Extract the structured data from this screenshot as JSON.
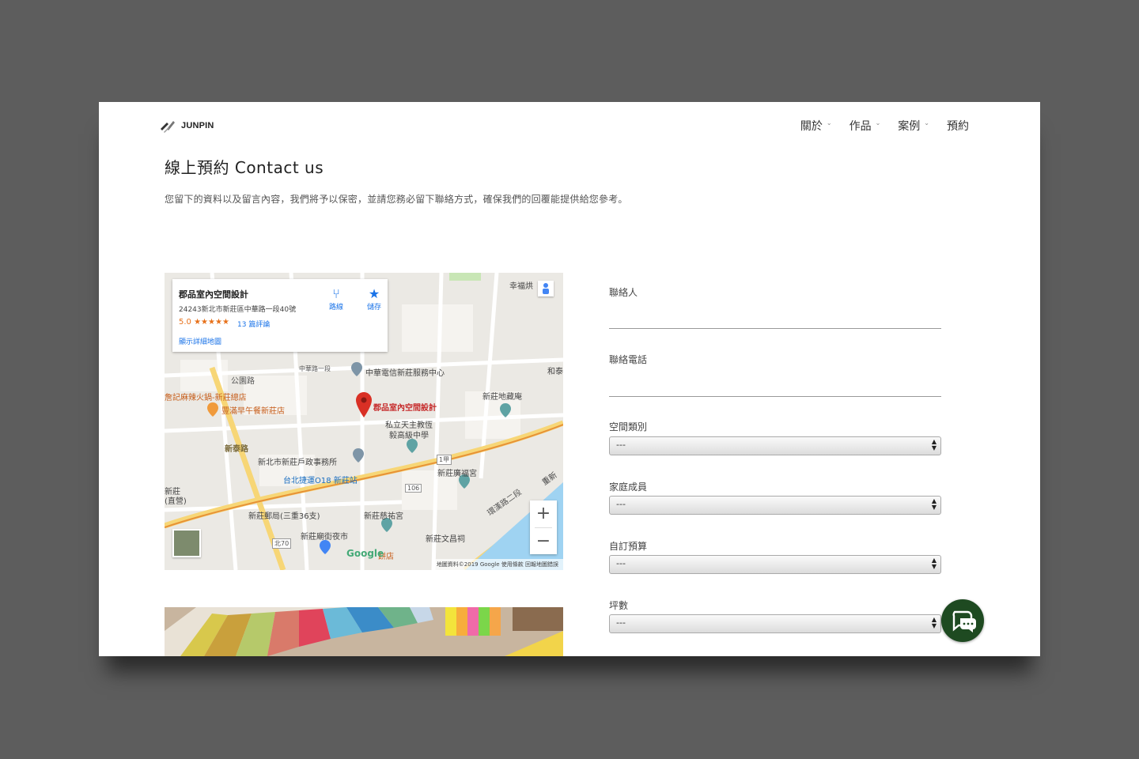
{
  "header": {
    "logo_text": "JUNPIN",
    "nav": [
      {
        "label": "關於",
        "has_dropdown": true
      },
      {
        "label": "作品",
        "has_dropdown": true
      },
      {
        "label": "案例",
        "has_dropdown": true
      },
      {
        "label": "預約",
        "has_dropdown": false
      }
    ]
  },
  "page": {
    "title": "線上預約 Contact us",
    "subtitle": "您留下的資料以及留言內容，我們將予以保密，並請您務必留下聯絡方式，確保我們的回覆能提供給您參考。"
  },
  "map": {
    "card": {
      "place_name": "郡品室內空間設計",
      "address": "24243新北市新莊區中華路一段40號",
      "rating": "5.0 ★★★★★",
      "reviews": "13 篇評論",
      "larger_map": "顯示詳細地圖",
      "directions": "路線",
      "save": "儲存"
    },
    "labels": {
      "marker": "郡品室內空間設計",
      "school_1": "私立天主教恆",
      "school_2": "毅高級中學",
      "telecom": "中華電信新莊服務中心",
      "temple_1": "新莊地藏庵",
      "restaurant_1": "詹記麻辣火鍋-新莊總店",
      "restaurant_2": "豐滿早午餐新莊店",
      "household": "新北市新莊戶政事務所",
      "metro": "台北捷運O18 新莊站",
      "temple_2": "新莊廣福宮",
      "post": "新莊郵局(三重36支)",
      "temple_3": "新莊慈祐宮",
      "night_market": "新莊廟街夜市",
      "temple_4": "新莊文昌祠",
      "road_1": "公園路",
      "road_2": "新泰路",
      "road_3": "中華路一段",
      "road_4": "環漢路二段",
      "area_1": "幸福烘",
      "area_2": "和泰",
      "area_3": "新莊",
      "area_4": "(直營)",
      "area_5": "重新",
      "route_1": "1甲",
      "route_2": "106",
      "route_3": "北70",
      "bakery": "餅店"
    },
    "footer": "地圖資料©2019 Google  使用條款  回報地圖錯誤",
    "google": "Google"
  },
  "form": {
    "fields": [
      {
        "label": "聯絡人",
        "type": "text"
      },
      {
        "label": "聯絡電話",
        "type": "text"
      },
      {
        "label": "空間類別",
        "type": "select",
        "value": "---"
      },
      {
        "label": "家庭成員",
        "type": "select",
        "value": "---"
      },
      {
        "label": "自訂預算",
        "type": "select",
        "value": "---"
      },
      {
        "label": "坪數",
        "type": "select",
        "value": "---"
      }
    ]
  },
  "colors": {
    "frame_bg": "#5d5d5d",
    "chat_button": "#1e4a21",
    "map_pin": "#d93025"
  }
}
